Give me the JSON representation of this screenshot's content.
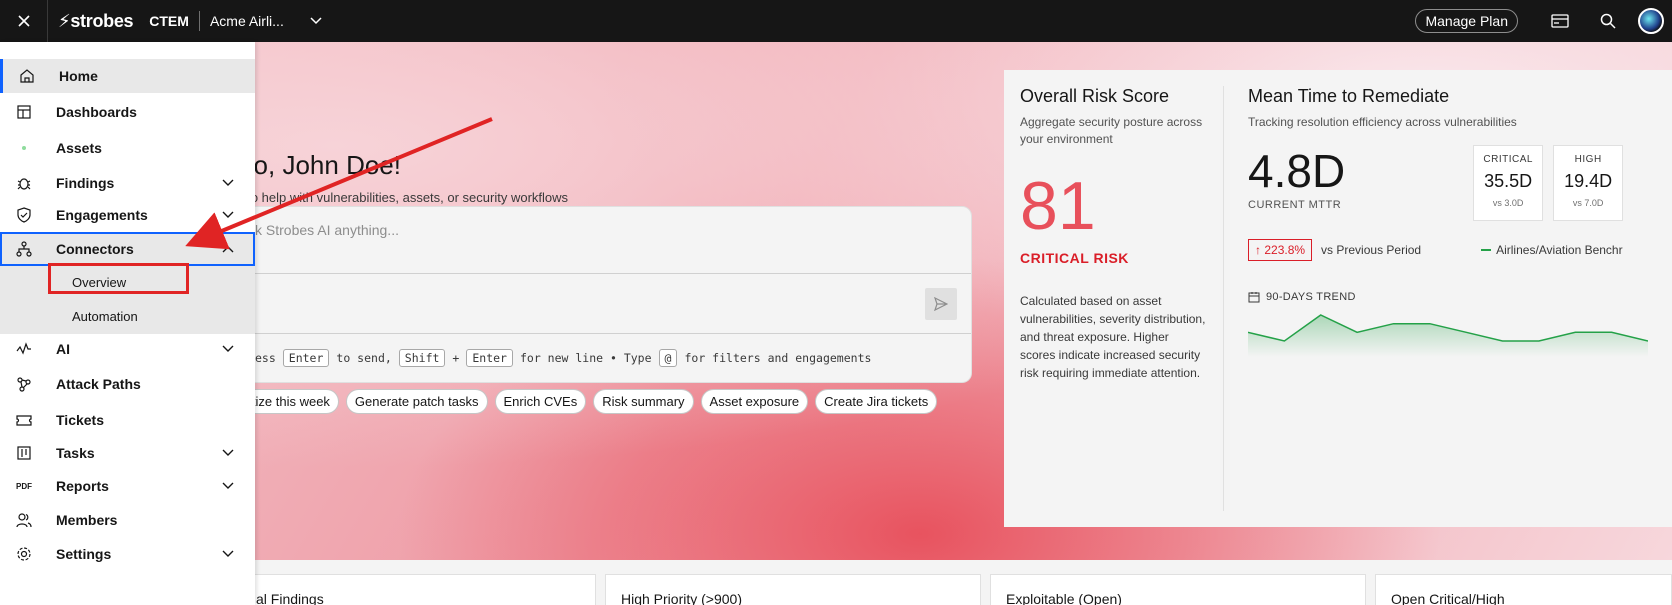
{
  "topbar": {
    "logo": "⚡strobes",
    "product": "CTEM",
    "org": "Acme Airli...",
    "manage_plan": "Manage Plan"
  },
  "sidebar": {
    "items": [
      {
        "label": "Home",
        "icon": "home-icon"
      },
      {
        "label": "Dashboards",
        "icon": "dashboard-icon"
      },
      {
        "label": "Assets",
        "icon": "assets-icon"
      },
      {
        "label": "Findings",
        "icon": "bug-icon"
      },
      {
        "label": "Engagements",
        "icon": "shield-icon"
      },
      {
        "label": "Connectors",
        "icon": "connectors-icon"
      },
      {
        "label": "AI",
        "icon": "ai-icon"
      },
      {
        "label": "Attack Paths",
        "icon": "attack-paths-icon"
      },
      {
        "label": "Tickets",
        "icon": "ticket-icon"
      },
      {
        "label": "Tasks",
        "icon": "tasks-icon"
      },
      {
        "label": "Reports",
        "icon": "pdf-icon"
      },
      {
        "label": "Members",
        "icon": "members-icon"
      },
      {
        "label": "Settings",
        "icon": "gear-icon"
      }
    ],
    "connectors_sub": [
      "Overview",
      "Automation"
    ],
    "pdf_text": "PDF"
  },
  "hero": {
    "greeting": "llo, John Doe!",
    "subtitle": "I to help with vulnerabilities, assets, or security workflows",
    "placeholder": "k Strobes AI anything...",
    "hint": {
      "p1": "ess",
      "k1": "Enter",
      "p2": "to send,",
      "k2": "Shift",
      "p3": "+",
      "k3": "Enter",
      "p4": "for new line • Type",
      "k4": "@",
      "p5": "for filters and engagements"
    },
    "chips": [
      "itize this week",
      "Generate patch tasks",
      "Enrich CVEs",
      "Risk summary",
      "Asset exposure",
      "Create Jira tickets"
    ]
  },
  "risk": {
    "title": "Overall Risk Score",
    "subtitle": "Aggregate security posture across your environment",
    "score": "81",
    "label": "CRITICAL RISK",
    "description": "Calculated based on asset vulnerabilities, severity distribution, and threat exposure. Higher scores indicate increased security risk requiring immediate attention."
  },
  "mttr": {
    "title": "Mean Time to Remediate",
    "subtitle": "Tracking resolution efficiency across vulnerabilities",
    "value": "4.8D",
    "caption": "CURRENT MTTR",
    "severities": [
      {
        "label": "CRITICAL",
        "value": "35.5D",
        "vs": "vs 3.0D"
      },
      {
        "label": "HIGH",
        "value": "19.4D",
        "vs": "vs 7.0D"
      }
    ],
    "change": "223.8%",
    "change_text": "vs Previous Period",
    "benchmark": "Airlines/Aviation Benchr",
    "trend_label": "90-DAYS TREND",
    "trend_values": [
      6,
      5,
      8,
      6,
      7,
      7,
      6,
      5,
      5,
      6,
      6,
      5
    ],
    "accent": "#24a148"
  },
  "tiles": [
    "al Findings",
    "High Priority (>900)",
    "Exploitable (Open)",
    "Open Critical/High"
  ],
  "colors": {
    "critical": "#da1e28",
    "primary": "#0f62fe",
    "annotation": "#e02424"
  }
}
